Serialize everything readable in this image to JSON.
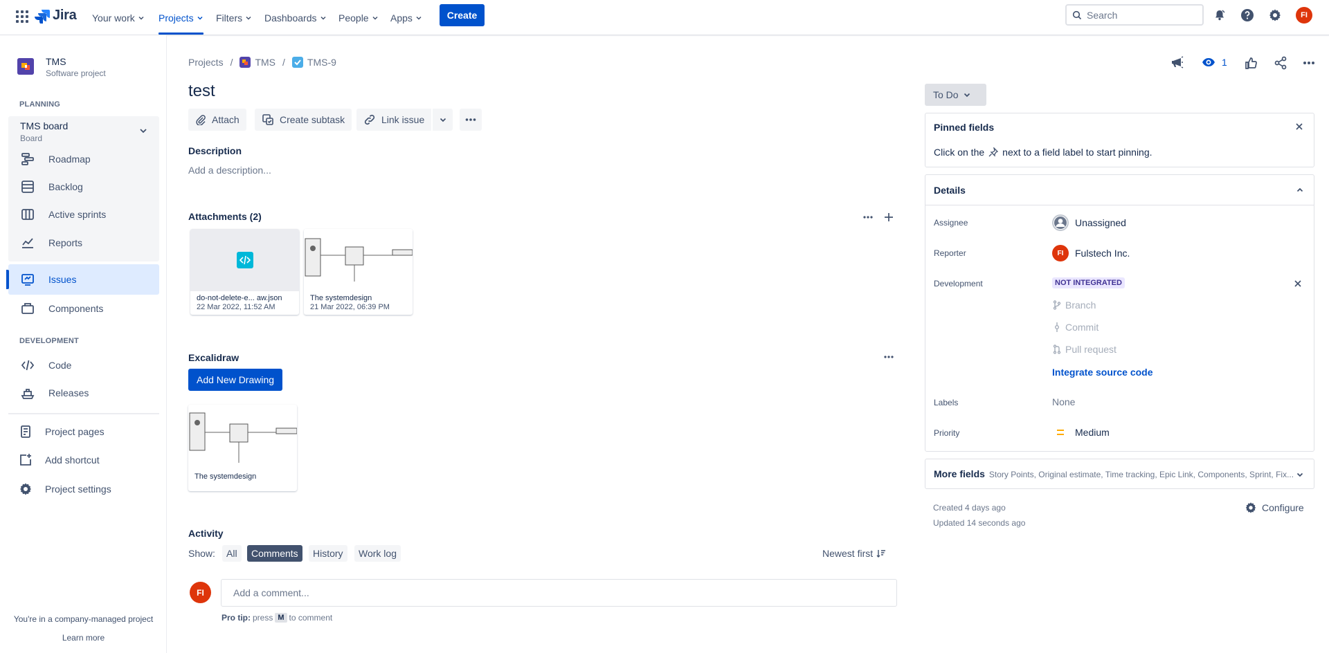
{
  "topnav": {
    "logo": "Jira",
    "items": [
      {
        "label": "Your work"
      },
      {
        "label": "Projects"
      },
      {
        "label": "Filters"
      },
      {
        "label": "Dashboards"
      },
      {
        "label": "People"
      },
      {
        "label": "Apps"
      }
    ],
    "create_label": "Create",
    "search_placeholder": "Search",
    "avatar_initials": "FI"
  },
  "sidebar": {
    "project_name": "TMS",
    "project_type": "Software project",
    "planning_header": "PLANNING",
    "board_title": "TMS board",
    "board_sub": "Board",
    "planning_items": [
      "Roadmap",
      "Backlog",
      "Active sprints",
      "Reports"
    ],
    "issues": "Issues",
    "components": "Components",
    "development_header": "DEVELOPMENT",
    "dev_items": [
      "Code",
      "Releases"
    ],
    "extra_items": [
      "Project pages",
      "Add shortcut",
      "Project settings"
    ],
    "company_note": "You're in a company-managed project",
    "learn_more": "Learn more"
  },
  "breadcrumb": {
    "projects": "Projects",
    "project": "TMS",
    "issue_key": "TMS-9"
  },
  "issue": {
    "title": "test",
    "actions": {
      "attach": "Attach",
      "create_subtask": "Create subtask",
      "link_issue": "Link issue"
    },
    "description_label": "Description",
    "description_placeholder": "Add a description...",
    "attachments_label": "Attachments (2)",
    "attachments": [
      {
        "name": "do-not-delete-e... aw.json",
        "date": "22 Mar 2022, 11:52 AM"
      },
      {
        "name": "The systemdesign",
        "date": "21 Mar 2022, 06:39 PM"
      }
    ],
    "excalidraw_label": "Excalidraw",
    "add_drawing": "Add New Drawing",
    "drawing_name": "The systemdesign",
    "activity_label": "Activity",
    "show_label": "Show:",
    "activity_filters": [
      "All",
      "Comments",
      "History",
      "Work log"
    ],
    "sort": "Newest first",
    "comment_placeholder": "Add a comment...",
    "pro_tip_bold": "Pro tip:",
    "pro_tip_press": "press",
    "pro_tip_key": "M",
    "pro_tip_rest": "to comment"
  },
  "header_actions": {
    "watch_count": "1"
  },
  "right": {
    "status": "To Do",
    "pinned_title": "Pinned fields",
    "pinned_text_a": "Click on the",
    "pinned_text_b": "next to a field label to start pinning.",
    "details_title": "Details",
    "fields": {
      "assignee_label": "Assignee",
      "assignee": "Unassigned",
      "reporter_label": "Reporter",
      "reporter": "Fulstech Inc.",
      "reporter_initials": "FI",
      "development_label": "Development",
      "dev_badge": "NOT INTEGRATED",
      "branch": "Branch",
      "commit": "Commit",
      "pull_request": "Pull request",
      "integrate": "Integrate source code",
      "labels_label": "Labels",
      "labels": "None",
      "priority_label": "Priority",
      "priority": "Medium"
    },
    "more_fields_title": "More fields",
    "more_fields_list": "Story Points, Original estimate, Time tracking, Epic Link, Components, Sprint, Fix...",
    "created": "Created 4 days ago",
    "updated": "Updated 14 seconds ago",
    "configure": "Configure"
  },
  "colors": {
    "brand": "#0052cc",
    "avatar": "#de350b",
    "selected_nav": "#deebff"
  }
}
